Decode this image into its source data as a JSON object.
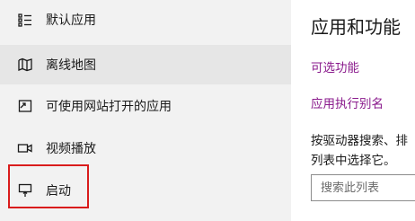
{
  "sidebar": {
    "items": [
      {
        "label": "默认应用",
        "icon": "default-apps-icon"
      },
      {
        "label": "离线地图",
        "icon": "offline-maps-icon",
        "selected": true
      },
      {
        "label": "可使用网站打开的应用",
        "icon": "apps-for-websites-icon"
      },
      {
        "label": "视频播放",
        "icon": "video-playback-icon"
      },
      {
        "label": "启动",
        "icon": "startup-icon"
      }
    ]
  },
  "main": {
    "title": "应用和功能",
    "links": [
      "可选功能",
      "应用执行别名"
    ],
    "description_lines": [
      "按驱动器搜索、排",
      "列表中选择它。"
    ],
    "search": {
      "placeholder": "搜索此列表"
    }
  },
  "colors": {
    "sidebar_bg": "#f2f2f2",
    "selected_bg": "#e6e6e6",
    "link": "#8a1a8c",
    "highlight": "#d91c1c"
  }
}
